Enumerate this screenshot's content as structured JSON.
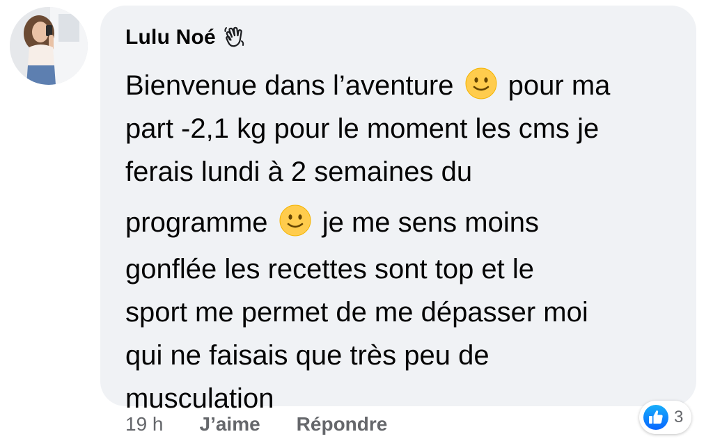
{
  "comment": {
    "author": "Lulu Noé",
    "author_badge_icon": "waving-hand-icon",
    "lines": [
      {
        "before": "Bienvenue dans l’aventure ",
        "emoji": "slightly-smiling-face-icon",
        "after": " pour ma"
      },
      {
        "text": "part -2,1 kg pour le moment les cms je"
      },
      {
        "text": "ferais lundi à 2 semaines du"
      },
      {
        "before": "programme ",
        "emoji": "slightly-smiling-face-icon",
        "after": " je me sens moins"
      },
      {
        "text": "gonflée les recettes sont top et le"
      },
      {
        "text": "sport me permet de me dépasser moi"
      },
      {
        "text": "qui ne faisais que très peu de"
      },
      {
        "text": "musculation"
      }
    ]
  },
  "reactions": {
    "icon": "like-icon",
    "count": "3"
  },
  "actions": {
    "timestamp": "19 h",
    "like_label": "J’aime",
    "reply_label": "Répondre"
  },
  "colors": {
    "bubble_bg": "#f0f2f5",
    "text": "#050505",
    "secondary_text": "#65676b",
    "like_blue": "#1877f2",
    "emoji_yellow": "#ffcc4d"
  }
}
